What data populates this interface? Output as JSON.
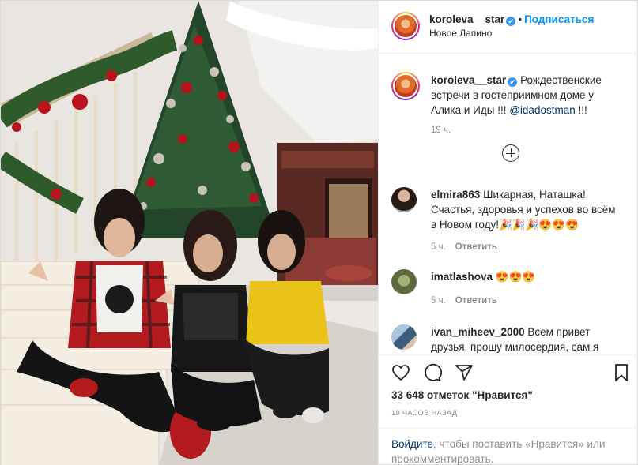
{
  "post": {
    "author": {
      "username": "koroleva__star",
      "verified_mark": "✔",
      "location": "Новое Лапино",
      "follow_label": "Подписаться"
    },
    "caption": {
      "text": "Рождественские встречи в гостеприимном доме у Алика и Иды !!! ",
      "mention": "@idadostman",
      "tail": " !!!",
      "time": "19 ч."
    },
    "comments": [
      {
        "username": "elmira863",
        "text": "Шикарная, Наташка! Счастья, здоровья и успехов во всём в Новом году!🎉🎉🎉😍😍😍",
        "time": "5 ч.",
        "reply_label": "Ответить"
      },
      {
        "username": "imatlashova",
        "text": "😍😍😍",
        "time": "5 ч.",
        "reply_label": "Ответить"
      },
      {
        "username": "ivan_miheev_2000",
        "text": "Всем привет друзья, прошу милосердия, сам я",
        "time": "",
        "reply_label": ""
      }
    ],
    "likes": "33 648 отметок \"Нравится\"",
    "timestamp": "19 ЧАСОВ НАЗАД",
    "login_prompt": {
      "link": "Войдите",
      "rest": ", чтобы поставить «Нравится» или прокомментировать."
    },
    "icons": [
      "heart-icon",
      "comment-icon",
      "share-icon",
      "bookmark-icon",
      "plus-circle-icon",
      "verified-badge-icon"
    ],
    "colors": {
      "follow_blue": "#0095f6",
      "verified_blue": "#3897f0",
      "link_dark_blue": "#00376b",
      "muted_gray": "#8e8e8e"
    }
  }
}
